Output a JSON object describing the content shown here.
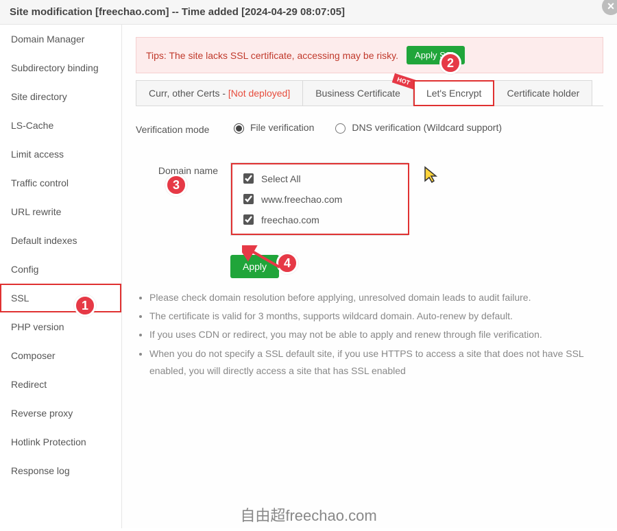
{
  "header": {
    "title": "Site modification [freechao.com] -- Time added [2024-04-29 08:07:05]"
  },
  "sidebar": {
    "items": [
      {
        "label": "Domain Manager"
      },
      {
        "label": "Subdirectory binding"
      },
      {
        "label": "Site directory"
      },
      {
        "label": "LS-Cache"
      },
      {
        "label": "Limit access"
      },
      {
        "label": "Traffic control"
      },
      {
        "label": "URL rewrite"
      },
      {
        "label": "Default indexes"
      },
      {
        "label": "Config"
      },
      {
        "label": "SSL",
        "active": true
      },
      {
        "label": "PHP version"
      },
      {
        "label": "Composer"
      },
      {
        "label": "Redirect"
      },
      {
        "label": "Reverse proxy"
      },
      {
        "label": "Hotlink Protection"
      },
      {
        "label": "Response log"
      }
    ]
  },
  "tip": {
    "text": "Tips: The site lacks SSL certificate, accessing may be risky.",
    "apply_label": "Apply SSL"
  },
  "tabs": {
    "curr_prefix": "Curr, other Certs - ",
    "curr_status": "[Not deployed]",
    "business": "Business Certificate",
    "hot": "HOT",
    "letsencrypt": "Let's Encrypt",
    "holder": "Certificate holder"
  },
  "form": {
    "verif_mode_label": "Verification mode",
    "file_verification": "File verification",
    "dns_verification": "DNS verification (Wildcard support)",
    "domain_name_label": "Domain name",
    "select_all": "Select All",
    "domain1": "www.freechao.com",
    "domain2": "freechao.com",
    "apply": "Apply"
  },
  "notes": [
    "Please check domain resolution before applying, unresolved domain leads to audit failure.",
    "The certificate is valid for 3 months, supports wildcard domain. Auto-renew by default.",
    "If you uses CDN or redirect, you may not be able to apply and renew through file verification.",
    "When you do not specify a SSL default site, if you use HTTPS to access a site that does not have SSL enabled, you will directly access a site that has SSL enabled"
  ],
  "annotations": {
    "b1": "1",
    "b2": "2",
    "b3": "3",
    "b4": "4"
  },
  "watermark": "自由超freechao.com"
}
